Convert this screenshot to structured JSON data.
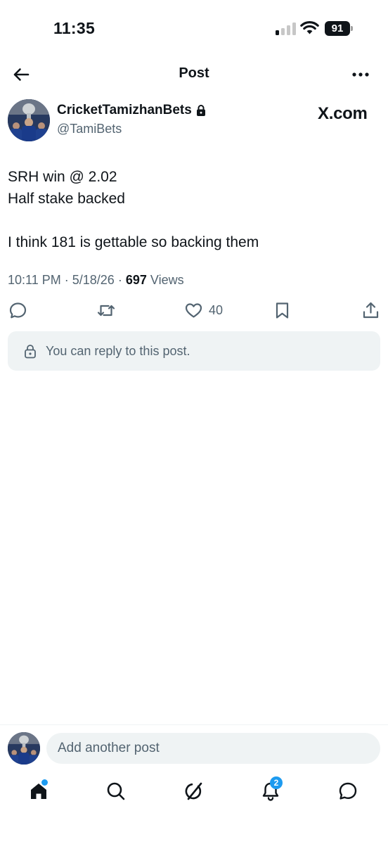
{
  "status_bar": {
    "time": "11:35",
    "battery": "91",
    "signal_bars_active": 1,
    "signal_bars_total": 4,
    "icons": [
      "signal-icon",
      "wifi-icon",
      "battery-icon"
    ]
  },
  "header": {
    "title": "Post",
    "icons": [
      "back-arrow-icon",
      "more-icon"
    ]
  },
  "author": {
    "name": "CricketTamizhanBets",
    "handle": "@TamiBets",
    "protected": true,
    "icons": [
      "avatar-trophy-photo",
      "lock-icon"
    ]
  },
  "watermark": "X.com",
  "post": {
    "lines": [
      "SRH win @ 2.02",
      "Half stake backed",
      "",
      "I think 181 is gettable so backing them"
    ],
    "time": "10:11 PM",
    "date": "5/18/26",
    "views_count": "697",
    "views_label": "Views",
    "separator": "·"
  },
  "actions": {
    "like_count": "40",
    "icons": [
      "reply-icon",
      "repost-icon",
      "like-icon",
      "bookmark-icon",
      "share-icon"
    ]
  },
  "reply_notice": {
    "text": "You can reply to this post.",
    "icon": "lock-icon"
  },
  "compose": {
    "placeholder": "Add another post"
  },
  "tab_bar": {
    "notifications_badge": "2",
    "home_has_dot": true,
    "icons": [
      "home-icon",
      "search-icon",
      "grok-icon",
      "notifications-icon",
      "messages-icon"
    ]
  },
  "colors": {
    "text": "#0f1419",
    "secondary": "#536471",
    "accent": "#1d9bf0",
    "surface": "#eff3f4"
  }
}
